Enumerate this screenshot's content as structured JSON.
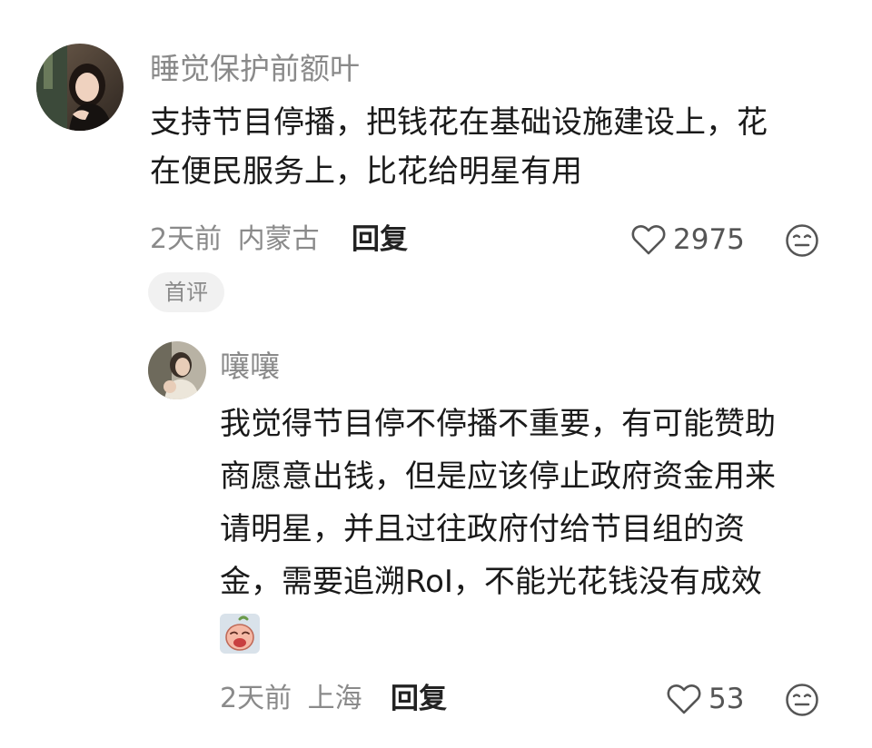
{
  "comments": [
    {
      "username": "睡觉保护前额叶",
      "content": [
        "支持节目停播，把钱花在基础设施建设上，花",
        "在便民服务上，比花给明星有用"
      ],
      "time": "2天前",
      "location": "内蒙古",
      "reply_label": "回复",
      "likes": "2975",
      "badge": "首评",
      "avatar_icon": "user-photo-avatar"
    }
  ],
  "replies": [
    {
      "username": "嚷嚷",
      "content": [
        "我觉得节目停不停播不重要，有可能赞助",
        "商愿意出钱，但是应该停止政府资金用来",
        "请明星，并且过往政府付给节目组的资",
        "金，需要追溯RoI，不能光花钱没有成效"
      ],
      "sticker": "crying-peach-sticker",
      "time": "2天前",
      "location": "上海",
      "reply_label": "回复",
      "likes": "53",
      "avatar_icon": "user-photo-avatar"
    }
  ],
  "icons": {
    "like": "heart-outline-icon",
    "dislike": "neutral-face-icon"
  },
  "colors": {
    "text_primary": "#1a1a1a",
    "text_secondary": "#8a8a8a",
    "badge_bg": "#f1f1f1",
    "background": "#ffffff"
  }
}
